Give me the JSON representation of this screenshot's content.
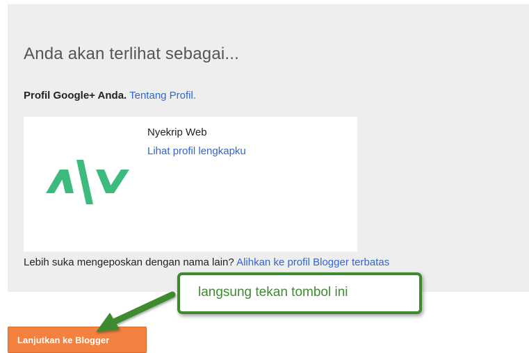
{
  "section": {
    "heading": "Anda akan terlihat sebagai..."
  },
  "profile": {
    "label_bold": "Profil Google+ Anda.",
    "about_link": "Tentang Profil.",
    "name": "Nyekrip Web",
    "view_link": "Lihat profil lengkapku",
    "logo_color": "#3dbb7e"
  },
  "alternate": {
    "prompt": "Lebih suka mengeposkan dengan nama lain?",
    "switch_link": "Alihkan ke profil Blogger terbatas"
  },
  "annotation": {
    "callout_text": "langsung tekan tombol ini",
    "color": "#3e8b2f"
  },
  "actions": {
    "continue_label": "Lanjutkan ke Blogger",
    "button_color": "#f3813f"
  }
}
